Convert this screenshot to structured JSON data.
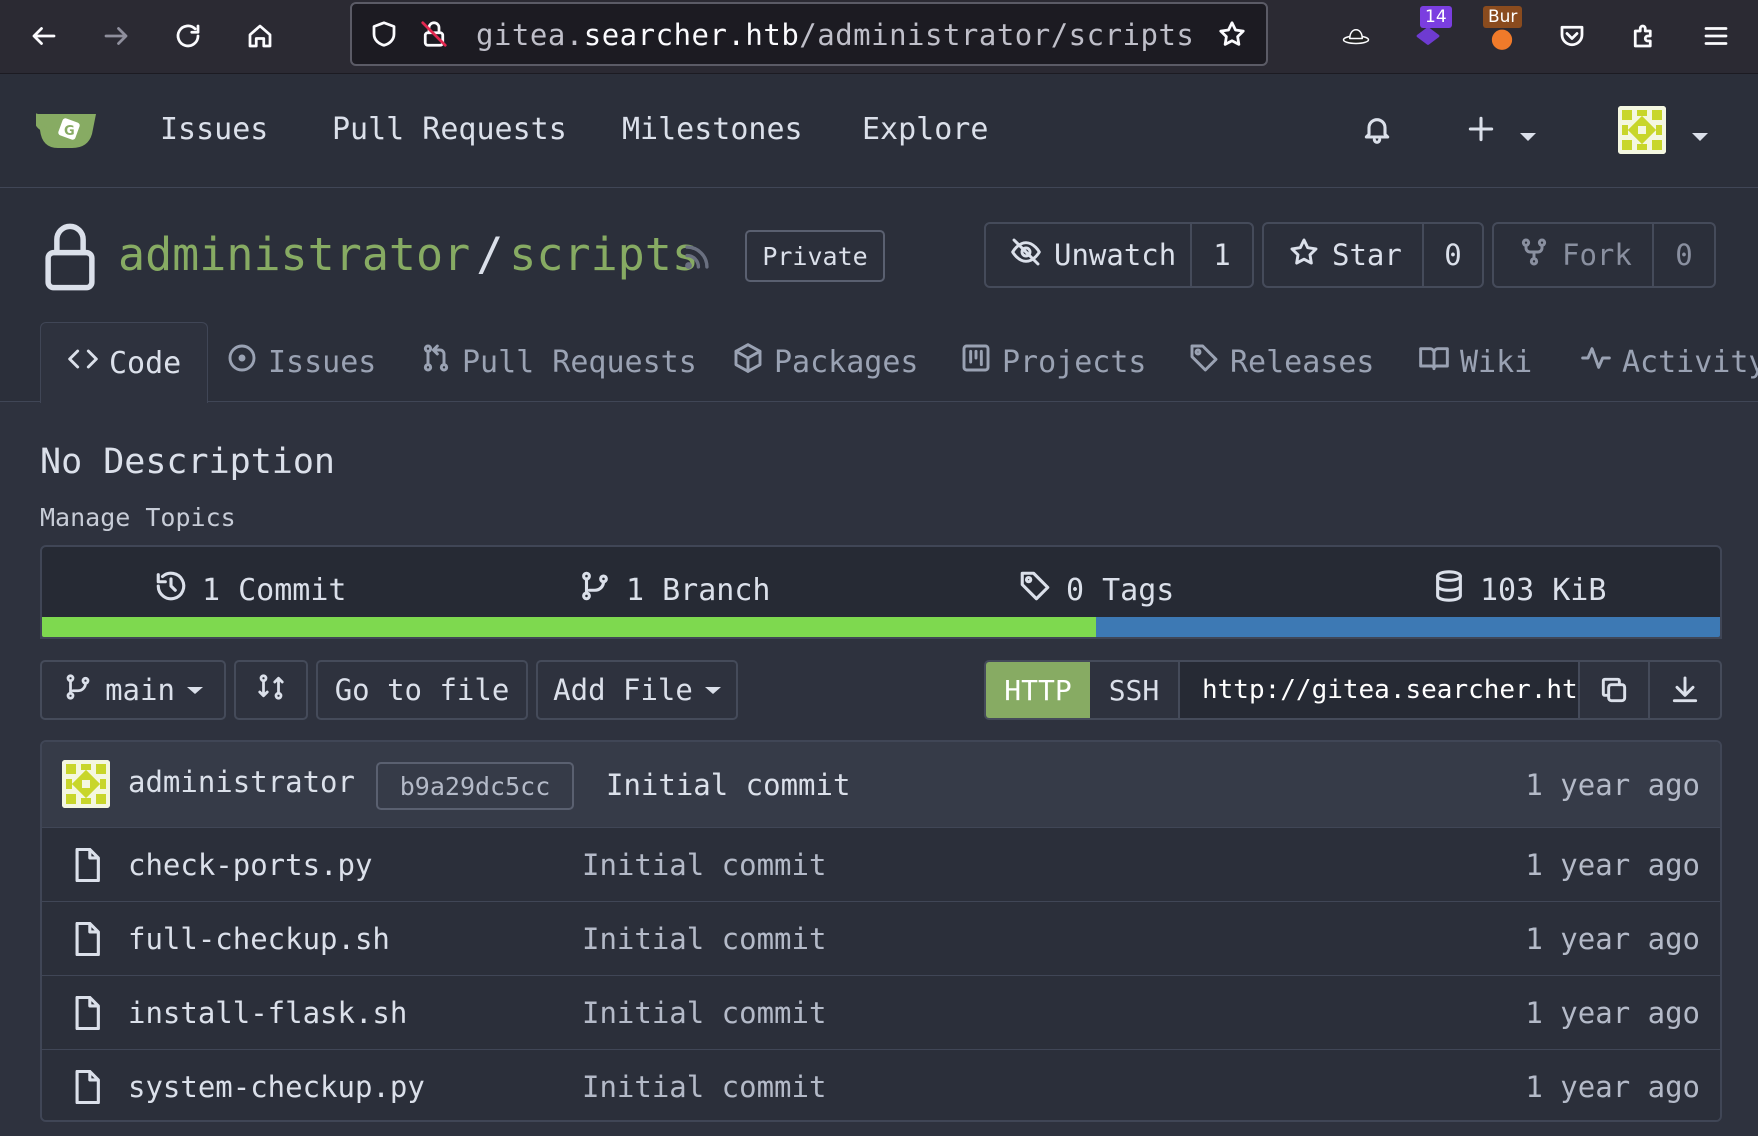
{
  "browser": {
    "url_prefix": "gitea.",
    "url_domain": "searcher.htb",
    "url_path": "/administrator/scripts",
    "extension_badge_count": "14",
    "burp_badge": "Bur"
  },
  "nav": {
    "items": [
      "Issues",
      "Pull Requests",
      "Milestones",
      "Explore"
    ]
  },
  "repo": {
    "owner": "administrator",
    "separator": "/",
    "name": "scripts",
    "visibility": "Private",
    "watch": {
      "label": "Unwatch",
      "count": "1"
    },
    "star": {
      "label": "Star",
      "count": "0"
    },
    "fork": {
      "label": "Fork",
      "count": "0"
    },
    "tabs": [
      "Code",
      "Issues",
      "Pull Requests",
      "Packages",
      "Projects",
      "Releases",
      "Wiki",
      "Activity"
    ],
    "description": "No Description",
    "manage_topics": "Manage Topics"
  },
  "stats": {
    "commits": "1 Commit",
    "branches": "1 Branch",
    "tags": "0 Tags",
    "size": "103 KiB",
    "language_fractions": {
      "python": 0.628,
      "shell": 0.372
    },
    "language_colors": {
      "python": "#7ed94f",
      "shell": "#3d79b4"
    }
  },
  "toolbar": {
    "branch": "main",
    "go_to_file": "Go to file",
    "add_file": "Add File",
    "clone_http": "HTTP",
    "clone_ssh": "SSH",
    "clone_url": "http://gitea.searcher.htb/administrator/scripts.git"
  },
  "latest_commit": {
    "author": "administrator",
    "sha": "b9a29dc5cc",
    "message": "Initial commit",
    "time": "1 year ago"
  },
  "files": [
    {
      "name": "check-ports.py",
      "message": "Initial commit",
      "time": "1 year ago"
    },
    {
      "name": "full-checkup.sh",
      "message": "Initial commit",
      "time": "1 year ago"
    },
    {
      "name": "install-flask.sh",
      "message": "Initial commit",
      "time": "1 year ago"
    },
    {
      "name": "system-checkup.py",
      "message": "Initial commit",
      "time": "1 year ago"
    }
  ],
  "colors": {
    "accent": "#87ab63",
    "background": "#2e323e",
    "header": "#2b2f3a"
  }
}
